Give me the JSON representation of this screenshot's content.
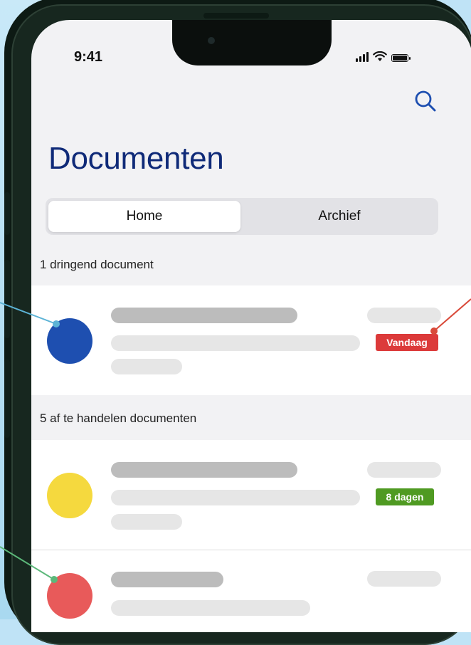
{
  "status_bar": {
    "time": "9:41"
  },
  "header": {
    "title": "Documenten"
  },
  "tabs": [
    {
      "label": "Home",
      "selected": true
    },
    {
      "label": "Archief",
      "selected": false
    }
  ],
  "sections": [
    {
      "header": "1 dringend document",
      "items": [
        {
          "avatar_color": "#1e4fb0",
          "badge": "Vandaag",
          "badge_color": "#dc3a3a"
        }
      ]
    },
    {
      "header": "5 af te handelen documenten",
      "items": [
        {
          "avatar_color": "#f5d93e",
          "badge": "8 dagen",
          "badge_color": "#4f9a22"
        },
        {
          "avatar_color": "#e85a5a",
          "badge": ""
        }
      ]
    }
  ],
  "colors": {
    "title": "#0f2a78",
    "accent": "#1e4fb0",
    "annotation_blue": "#5cb3d6",
    "annotation_red": "#d94a3a",
    "annotation_green": "#5cb87a"
  },
  "icons": [
    "search-icon",
    "signal-icon",
    "wifi-icon",
    "battery-icon"
  ]
}
